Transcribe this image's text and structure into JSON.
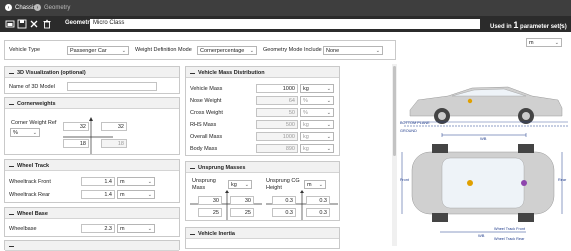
{
  "breadcrumb": {
    "items": [
      "Chassis",
      "Geometry"
    ]
  },
  "toolbar": {
    "geometry_label": "Geometry",
    "geometry_name": "Micro Class",
    "used_in_prefix": "Used in",
    "used_in_count": "1",
    "used_in_suffix": "parameter set(s)"
  },
  "settings": {
    "vehicle_type_label": "Vehicle Type",
    "vehicle_type_value": "Passenger Car",
    "weight_mode_label": "Weight Definition Mode",
    "weight_mode_value": "Cornerpercentage",
    "geometry_mode_label": "Geometry Mode Include",
    "geometry_mode_value": "None"
  },
  "viz3d": {
    "title": "3D Visualization (optional)",
    "name_label": "Name of 3D Model",
    "name_value": ""
  },
  "cornerweights": {
    "title": "Cornerweights",
    "ref_label": "Corner Weight Ref",
    "unit": "%",
    "fl": "32",
    "fr": "32",
    "rl": "18",
    "rr": "18"
  },
  "wheeltrack": {
    "title": "Wheel Track",
    "front_label": "Wheeltrack Front",
    "front_value": "1.4",
    "front_unit": "m",
    "rear_label": "Wheeltrack Rear",
    "rear_value": "1.4",
    "rear_unit": "m"
  },
  "wheelbase": {
    "title": "Wheel Base",
    "label": "Wheelbase",
    "value": "2.3",
    "unit": "m"
  },
  "massdist": {
    "title": "Vehicle Mass Distribution",
    "rows": [
      {
        "label": "Vehicle Mass",
        "value": "1000",
        "unit": "kg",
        "readonly": false
      },
      {
        "label": "Nose Weight",
        "value": "64",
        "unit": "%",
        "readonly": true
      },
      {
        "label": "Cross Weight",
        "value": "50",
        "unit": "%",
        "readonly": true
      },
      {
        "label": "RHS Mass",
        "value": "500",
        "unit": "kg",
        "readonly": true
      },
      {
        "label": "Overall Mass",
        "value": "1000",
        "unit": "kg",
        "readonly": true
      },
      {
        "label": "Body Mass",
        "value": "890",
        "unit": "kg",
        "readonly": true
      }
    ]
  },
  "unsprung": {
    "title": "Unsprung Masses",
    "mass_label": "Unsprung Mass",
    "mass_unit": "kg",
    "cg_label": "Unsprung CG Height",
    "cg_unit": "m",
    "mass_fl": "30",
    "mass_fr": "30",
    "mass_rl": "25",
    "mass_rr": "25",
    "cg_fl": "0.3",
    "cg_fr": "0.3",
    "cg_rl": "0.3",
    "cg_rr": "0.3"
  },
  "inertia": {
    "title": "Vehicle Inertia"
  },
  "visual": {
    "unit_value": "m",
    "body_label": "BOTTOM PLANE",
    "ground_label": "GROUND",
    "wb_label": "WB",
    "track_front_label": "Wheel Track Front",
    "track_rear_label": "Wheel Track Rear",
    "wb_side_label": "WB",
    "front_label": "Front",
    "rear_label": "Rear"
  },
  "colors": {
    "topbar": "#3e3e3e",
    "toolbar": "#2b2b2b",
    "accent": "#1e3a8a",
    "car": "#c8c8c8"
  }
}
